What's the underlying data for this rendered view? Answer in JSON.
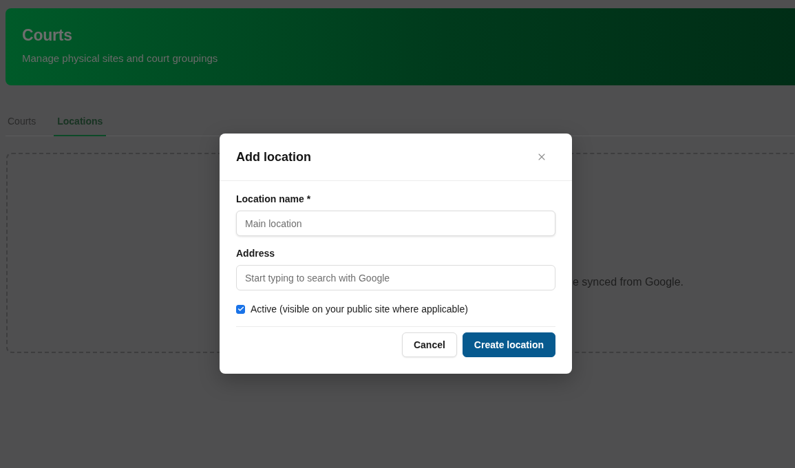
{
  "header": {
    "title": "Courts",
    "subtitle": "Manage physical sites and court groupings"
  },
  "tabs": [
    {
      "label": "Courts",
      "selected": false
    },
    {
      "label": "Locations",
      "selected": true
    }
  ],
  "empty_state": {
    "text": "e synced from Google."
  },
  "dialog": {
    "title": "Add location",
    "fields": [
      {
        "label": "Location name *",
        "placeholder": "Main location"
      },
      {
        "label": "Address",
        "placeholder": "Start typing to search with Google"
      }
    ],
    "checkbox": {
      "label": "Active (visible on your public site where applicable)",
      "checked": true
    },
    "buttons": [
      {
        "label": "Cancel",
        "kind": "secondary"
      },
      {
        "label": "Create location",
        "kind": "primary"
      }
    ]
  }
}
